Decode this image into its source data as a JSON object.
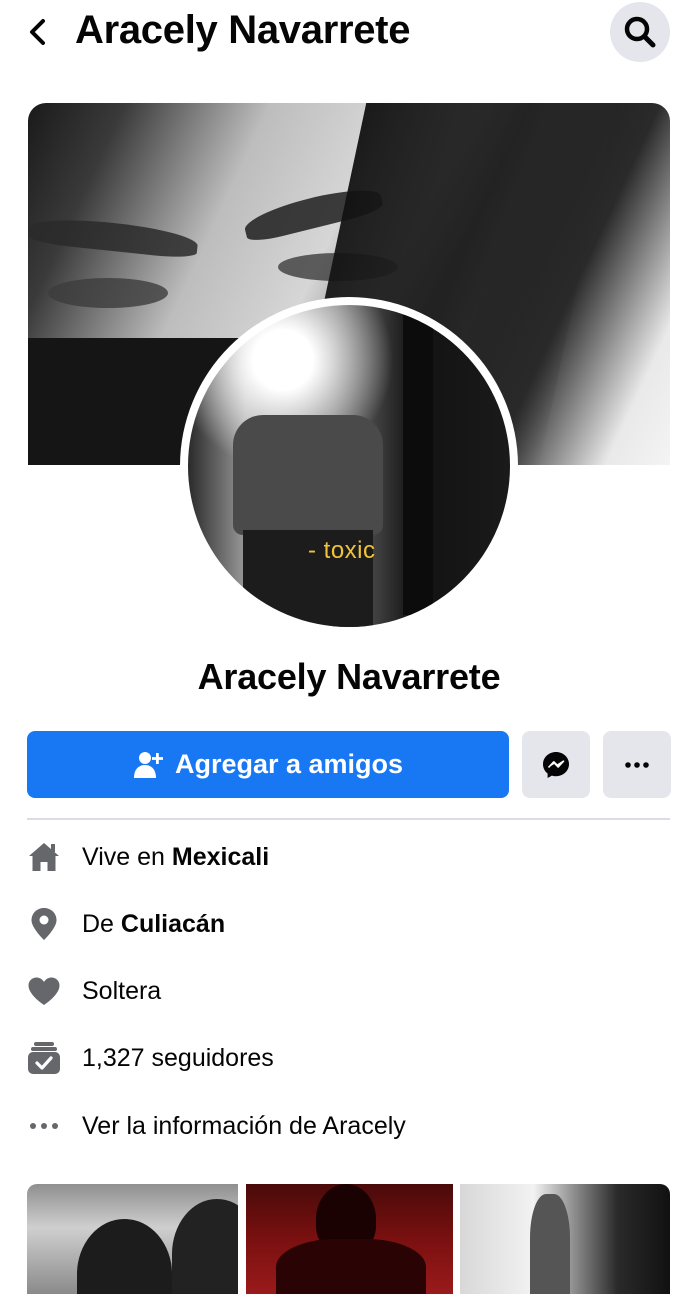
{
  "header": {
    "title": "Aracely Navarrete",
    "back_icon": "chevron-left-icon",
    "search_icon": "search-icon"
  },
  "profile": {
    "name": "Aracely Navarrete",
    "avatar_caption": "- toxic"
  },
  "actions": {
    "add_friend_label": "Agregar a amigos",
    "accent_color": "#1877f2",
    "messenger_icon": "messenger-icon",
    "more_icon": "more-dots-icon"
  },
  "info": {
    "lives_prefix": "Vive en ",
    "lives_place": "Mexicali",
    "from_prefix": "De ",
    "from_place": "Culiacán",
    "relationship": "Soltera",
    "followers": "1,327 seguidores",
    "see_info": "Ver la información de Aracely"
  }
}
